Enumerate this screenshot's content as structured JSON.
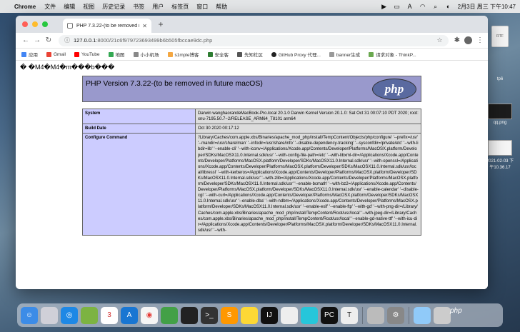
{
  "menubar": {
    "app_name": "Chrome",
    "menus": [
      "文件",
      "编辑",
      "视图",
      "历史记录",
      "书签",
      "用户",
      "标签页",
      "窗口",
      "帮助"
    ],
    "clock": "2月3日 周三 下午10:47"
  },
  "desktop": {
    "items": [
      {
        "label": "",
        "file_text": "RTF"
      },
      {
        "label": "tp6"
      },
      {
        "label": "qq.png"
      },
      {
        "label": "2021-02-03 下午10.36.17"
      }
    ]
  },
  "browser": {
    "tab_title": "PHP 7.3.22-(to be removed in future macOS)",
    "url_host": "127.0.0.1",
    "url_path": ":8000/21c6f979723693499b6b505fbccae9dc.php",
    "bookmarks": [
      "应用",
      "Gmail",
      "YouTube",
      "地图",
      "小小机场",
      "s1mple博客",
      "安全客",
      "先知社区",
      "GitHub Proxy 代理...",
      "banner生成",
      "请求对象 - ThinkP..."
    ]
  },
  "page": {
    "garbled_text": "� �M4�M4�m���b���",
    "php_title": "PHP Version 7.3.22-(to be removed in future macOS)",
    "php_logo": "php",
    "rows": [
      {
        "key": "System",
        "value": "Darwin wanghaorandeMacBook-Pro.local 20.1.0 Darwin Kernel Version 20.1.0: Sat Oct 31 00:07:10 PDT 2020; root:xnu-7195.50.7~2/RELEASE_ARM64_T8101 arm64"
      },
      {
        "key": "Build Date",
        "value": "Oct 30 2020 00:17:12"
      },
      {
        "key": "Configure Command",
        "value": "'/Library/Caches/com.apple.xbs/Binaries/apache_mod_php/install/TempContent/Objects/php/configure' '--prefix=/usr' '--mandir=/usr/share/man' '--infodir=/usr/share/info' '--disable-dependency-tracking' '--sysconfdir=/private/etc' '--with-libdir=lib' '--enable-cli' '--with-iconv=/Applications/Xcode.app/Contents/Developer/Platforms/MacOSX.platform/Developer/SDKs/MacOSX11.0.Internal.sdk/usr' '--with-config-file-path=/etc' '--with-libxml-dir=/Applications/Xcode.app/Contents/Developer/Platforms/MacOSX.platform/Developer/SDKs/MacOSX11.0.Internal.sdk/usr' '--with-openssl=/Applications/Xcode.app/Contents/Developer/Platforms/MacOSX.platform/Developer/SDKs/MacOSX11.0.Internal.sdk/usr/local/libressl' '--with-kerberos=/Applications/Xcode.app/Contents/Developer/Platforms/MacOSX.platform/Developer/SDKs/MacOSX11.0.Internal.sdk/usr' '--with-zlib=/Applications/Xcode.app/Contents/Developer/Platforms/MacOSX.platform/Developer/SDKs/MacOSX11.0.Internal.sdk/usr' '--enable-bcmath' '--with-bz2=/Applications/Xcode.app/Contents/Developer/Platforms/MacOSX.platform/Developer/SDKs/MacOSX11.0.Internal.sdk/usr' '--enable-calendar' '--disable-cgi' '--with-curl=/Applications/Xcode.app/Contents/Developer/Platforms/MacOSX.platform/Developer/SDKs/MacOSX11.0.Internal.sdk/usr' '--enable-dba' '--with-ndbm=/Applications/Xcode.app/Contents/Developer/Platforms/MacOSX.platform/Developer/SDKs/MacOSX11.0.Internal.sdk/usr' '--enable-exif' '--enable-ftp' '--with-gd' '--with-png-dir=/Library/Caches/com.apple.xbs/Binaries/apache_mod_php/install/TempContent/Root/usr/local' '--with-jpeg-dir=/Library/Caches/com.apple.xbs/Binaries/apache_mod_php/install/TempContent/Root/usr/local' '--enable-gd-native-ttf' '--with-icu-dir=/Applications/Xcode.app/Contents/Developer/Platforms/MacOSX.platform/Developer/SDKs/MacOSX11.0.Internal.sdk/usr' '--with-"
      }
    ]
  },
  "watermark": "php",
  "colors": {
    "php_header": "#9999cc",
    "key_cell": "#ccccff",
    "value_cell": "#dddddd"
  }
}
